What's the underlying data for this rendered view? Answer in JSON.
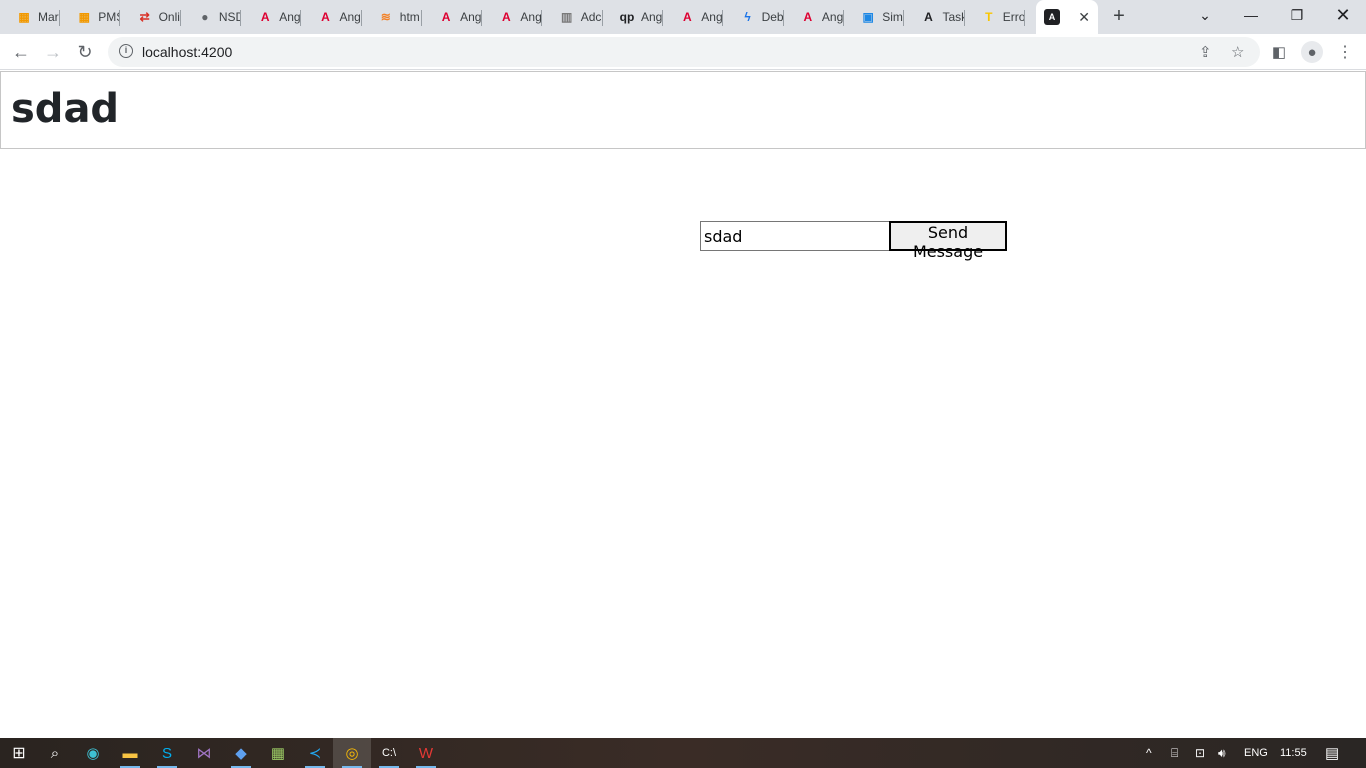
{
  "browser": {
    "tabs": [
      {
        "label": "Mar",
        "icon": "apps-grid-icon",
        "color": "#f29900"
      },
      {
        "label": "PMS",
        "icon": "apps-grid-icon",
        "color": "#f29900"
      },
      {
        "label": "Onli",
        "icon": "swap-arrows-icon",
        "color": "#d93025"
      },
      {
        "label": "NSD",
        "icon": "globe-icon",
        "color": "#5f6368"
      },
      {
        "label": "Ang",
        "icon": "angular-icon",
        "color": "#dd0031"
      },
      {
        "label": "Ang",
        "icon": "angular-icon",
        "color": "#dd0031"
      },
      {
        "label": "htm",
        "icon": "stackoverflow-icon",
        "color": "#f48024"
      },
      {
        "label": "Ang",
        "icon": "angular-icon",
        "color": "#dd0031"
      },
      {
        "label": "Ang",
        "icon": "angular-icon",
        "color": "#dd0031"
      },
      {
        "label": "Adc",
        "icon": "bars-icon",
        "color": "#7a7a7a"
      },
      {
        "label": "Ang",
        "icon": "qp-icon",
        "color": "#202124"
      },
      {
        "label": "Ang",
        "icon": "angular-icon",
        "color": "#dd0031"
      },
      {
        "label": "Deb",
        "icon": "bolt-icon",
        "color": "#1a73e8"
      },
      {
        "label": "Ang",
        "icon": "angular-icon",
        "color": "#dd0031"
      },
      {
        "label": "Sim",
        "icon": "square-icon",
        "color": "#1e88e5"
      },
      {
        "label": "Task",
        "icon": "angular-icon",
        "color": "#202124"
      },
      {
        "label": "Erro",
        "icon": "tek-icon",
        "color": "#f9c600"
      }
    ],
    "active_tab_icon": "angular-icon",
    "url": "localhost:4200"
  },
  "page": {
    "title": "sdad",
    "message_input_value": "sdad",
    "send_button_label": "Send Message"
  },
  "taskbar": {
    "language": "ENG",
    "time": "11:55"
  }
}
